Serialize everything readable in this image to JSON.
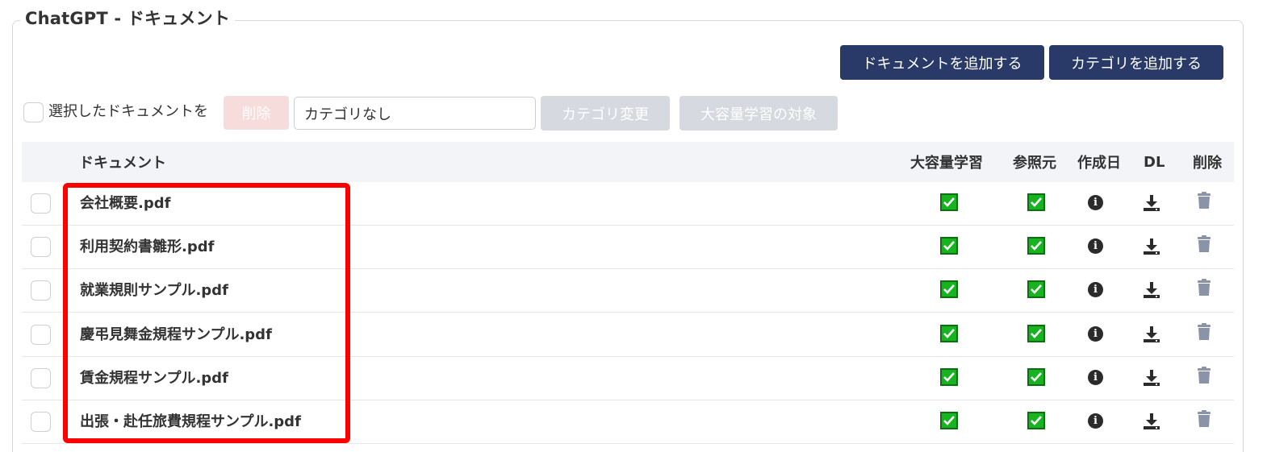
{
  "panel": {
    "title": "ChatGPT - ドキュメント"
  },
  "toolbar": {
    "add_document_label": "ドキュメントを追加する",
    "add_category_label": "カテゴリを追加する"
  },
  "bulk": {
    "select_label": "選択したドキュメントを",
    "delete_label": "削除",
    "category_value": "カテゴリなし",
    "change_category_label": "カテゴリ変更",
    "large_target_label": "大容量学習の対象"
  },
  "table": {
    "headers": {
      "document": "ドキュメント",
      "large": "大容量学習",
      "ref": "参照元",
      "date": "作成日",
      "dl": "DL",
      "delete": "削除"
    },
    "rows": [
      {
        "name": "会社概要.pdf",
        "large_learning": true,
        "reference": true
      },
      {
        "name": "利用契約書雛形.pdf",
        "large_learning": true,
        "reference": true
      },
      {
        "name": "就業規則サンプル.pdf",
        "large_learning": true,
        "reference": true
      },
      {
        "name": "慶弔見舞金規程サンプル.pdf",
        "large_learning": true,
        "reference": true
      },
      {
        "name": "賃金規程サンプル.pdf",
        "large_learning": true,
        "reference": true
      },
      {
        "name": "出張・赴任旅費規程サンプル.pdf",
        "large_learning": true,
        "reference": true
      }
    ]
  },
  "colors": {
    "primary": "#293a68",
    "highlight": "#ff0000",
    "check_green": "#18b320",
    "delete_disabled": "#f7dcdc",
    "button_disabled": "#d6d9df"
  },
  "icons": {
    "checked": "check-icon",
    "info": "info-icon",
    "download": "download-icon",
    "trash": "trash-icon"
  }
}
